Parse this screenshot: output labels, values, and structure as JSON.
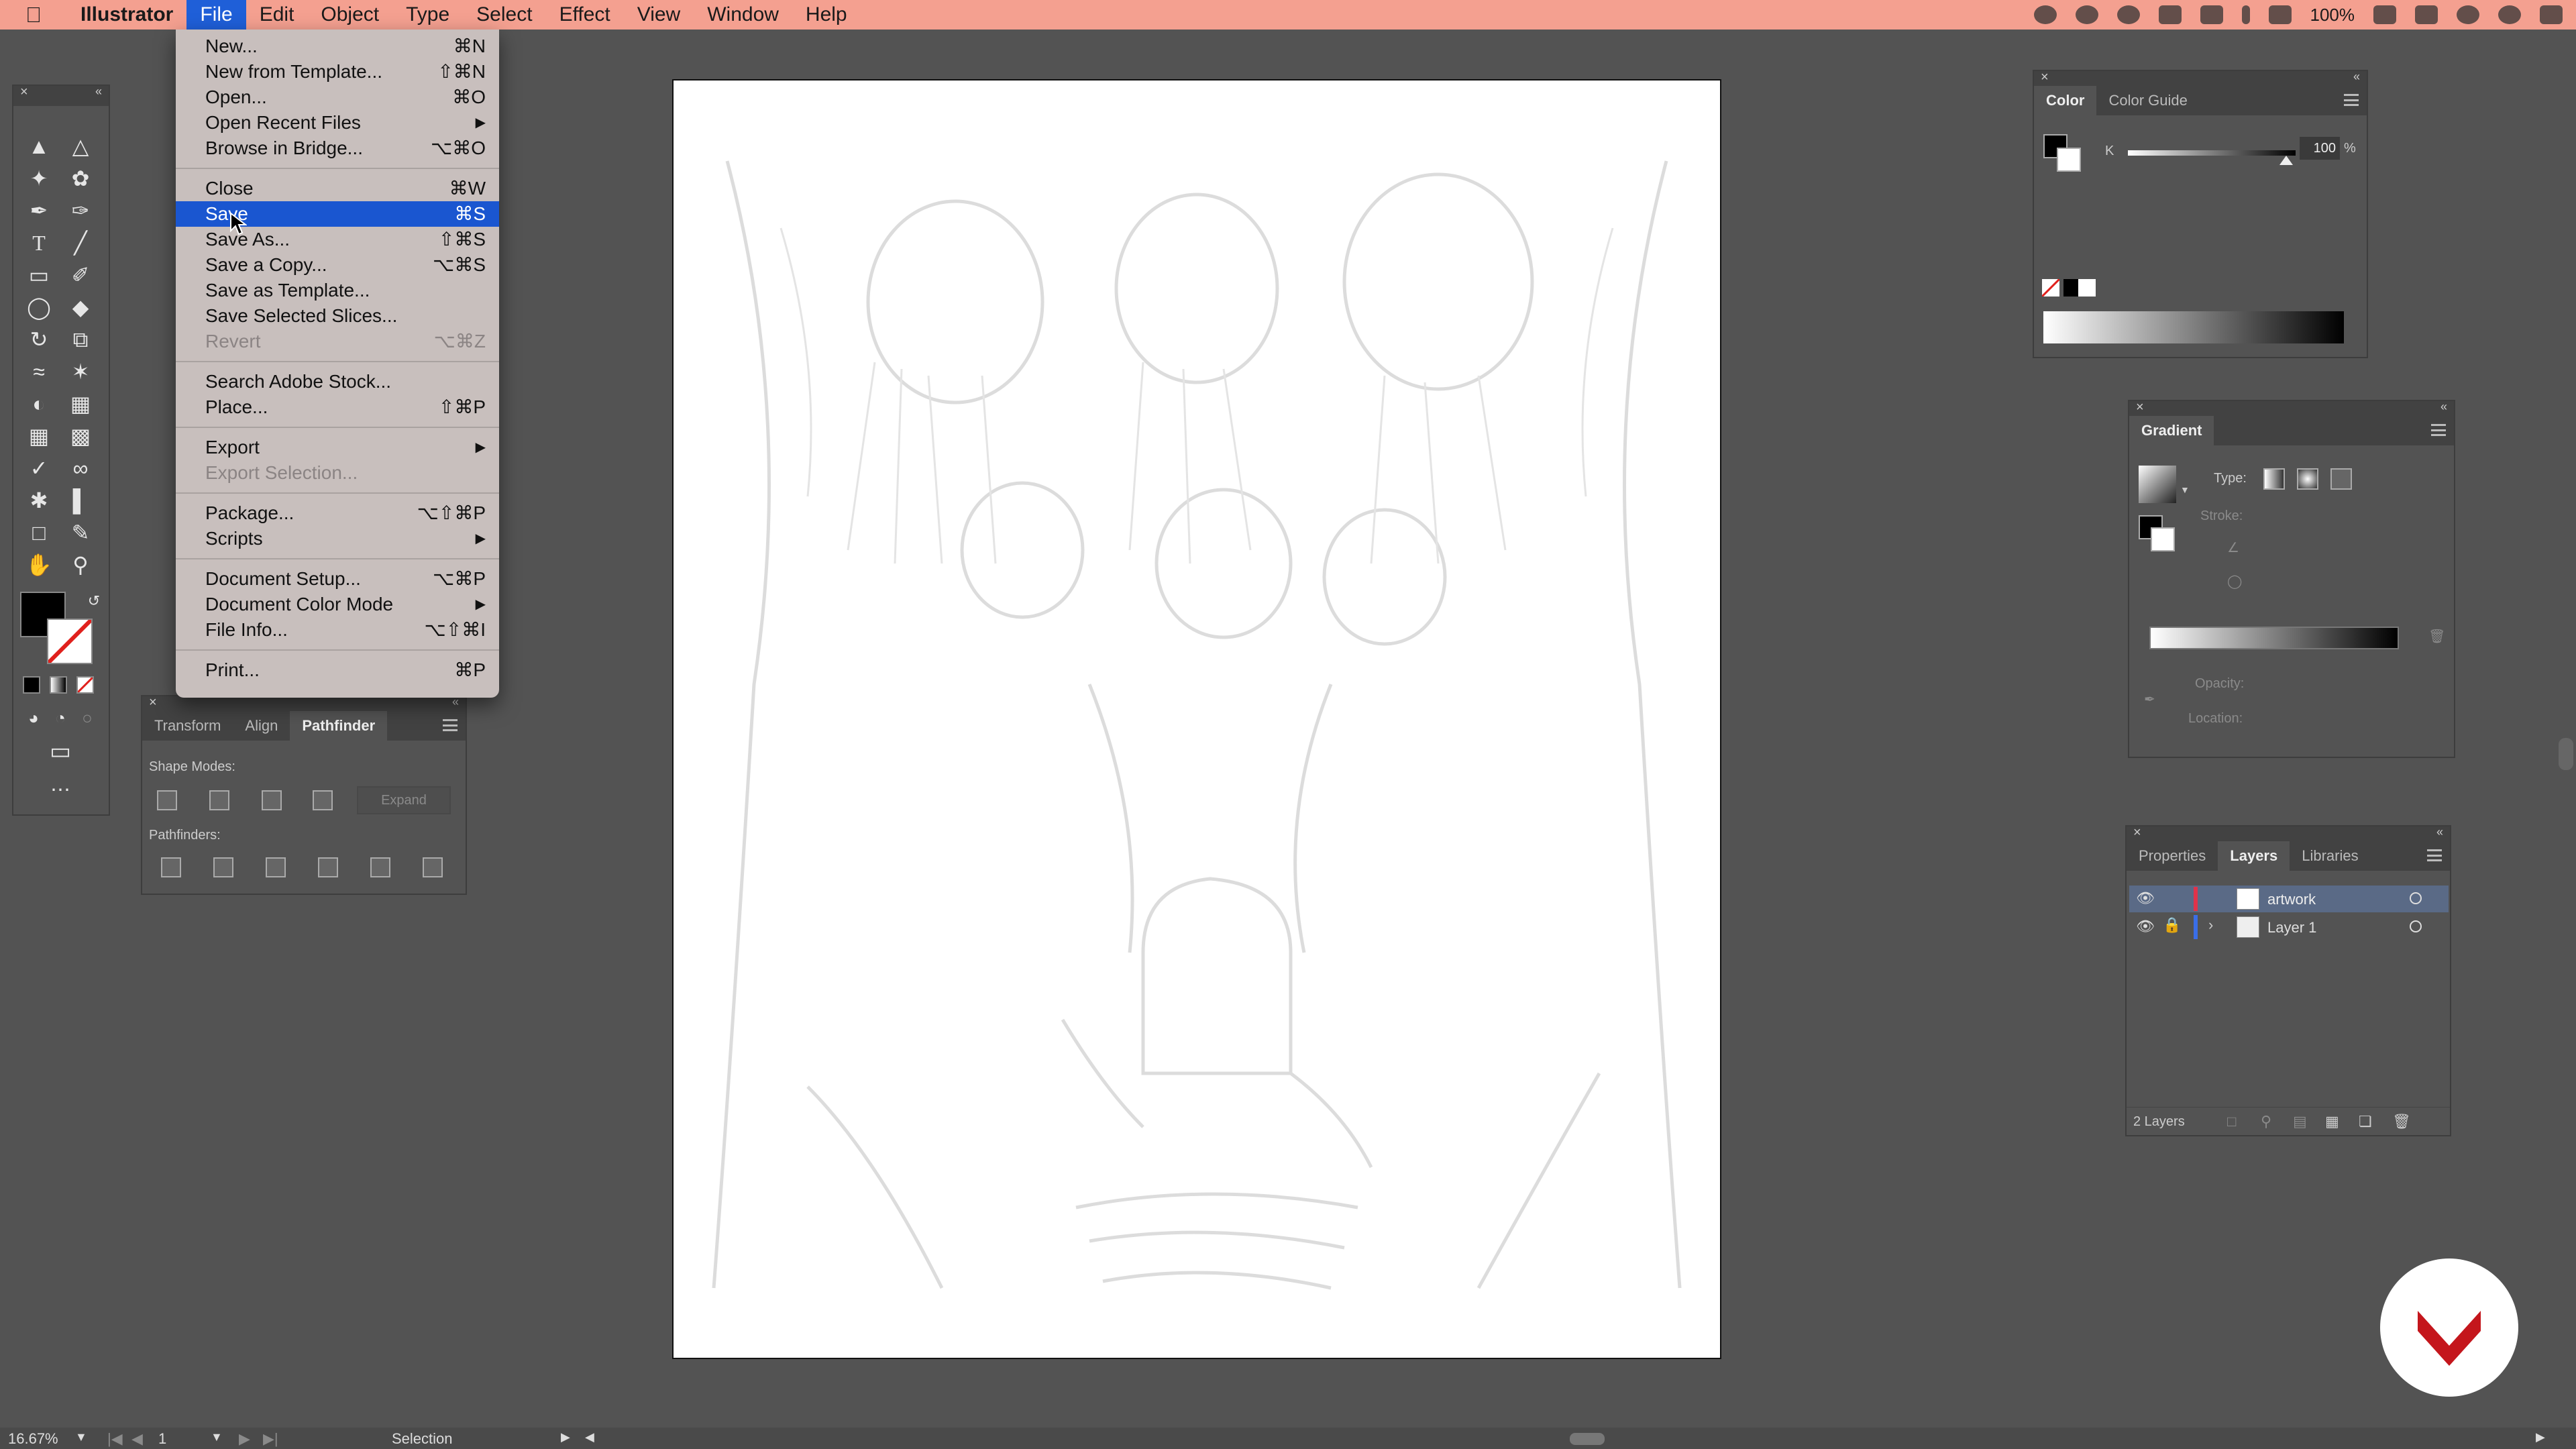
{
  "menubar": {
    "app_name": "Illustrator",
    "items": [
      "File",
      "Edit",
      "Object",
      "Type",
      "Select",
      "Effect",
      "View",
      "Window",
      "Help"
    ],
    "battery": "100%"
  },
  "file_menu": {
    "items": [
      {
        "label": "New...",
        "shortcut": "⌘N"
      },
      {
        "label": "New from Template...",
        "shortcut": "⇧⌘N"
      },
      {
        "label": "Open...",
        "shortcut": "⌘O"
      },
      {
        "label": "Open Recent Files",
        "shortcut": "▶"
      },
      {
        "label": "Browse in Bridge...",
        "shortcut": "⌥⌘O"
      },
      {
        "label": "Close",
        "shortcut": "⌘W"
      },
      {
        "label": "Save",
        "shortcut": "⌘S"
      },
      {
        "label": "Save As...",
        "shortcut": "⇧⌘S"
      },
      {
        "label": "Save a Copy...",
        "shortcut": "⌥⌘S"
      },
      {
        "label": "Save as Template...",
        "shortcut": ""
      },
      {
        "label": "Save Selected Slices...",
        "shortcut": ""
      },
      {
        "label": "Revert",
        "shortcut": "⌥⌘Z"
      },
      {
        "label": "Search Adobe Stock...",
        "shortcut": ""
      },
      {
        "label": "Place...",
        "shortcut": "⇧⌘P"
      },
      {
        "label": "Export",
        "shortcut": "▶"
      },
      {
        "label": "Export Selection...",
        "shortcut": ""
      },
      {
        "label": "Package...",
        "shortcut": "⌥⇧⌘P"
      },
      {
        "label": "Scripts",
        "shortcut": "▶"
      },
      {
        "label": "Document Setup...",
        "shortcut": "⌥⌘P"
      },
      {
        "label": "Document Color Mode",
        "shortcut": "▶"
      },
      {
        "label": "File Info...",
        "shortcut": "⌥⇧⌘I"
      },
      {
        "label": "Print...",
        "shortcut": "⌘P"
      }
    ]
  },
  "color_panel": {
    "tabs": [
      "Color",
      "Color Guide"
    ],
    "channel_label": "K",
    "value": "100",
    "unit": "%"
  },
  "gradient_panel": {
    "title": "Gradient",
    "type_label": "Type:",
    "stroke_label": "Stroke:",
    "opacity_label": "Opacity:",
    "location_label": "Location:"
  },
  "layers_panel": {
    "tabs": [
      "Properties",
      "Layers",
      "Libraries"
    ],
    "layers": [
      {
        "name": "artwork",
        "color": "#e0334a"
      },
      {
        "name": "Layer 1",
        "color": "#3a6ee8"
      }
    ],
    "count": "2 Layers"
  },
  "pathfinder_panel": {
    "tabs": [
      "Transform",
      "Align",
      "Pathfinder"
    ],
    "shape_modes_label": "Shape Modes:",
    "expand_label": "Expand",
    "pathfinders_label": "Pathfinders:"
  },
  "statusbar": {
    "zoom": "16.67%",
    "artboard": "1",
    "tool": "Selection"
  },
  "colors": {
    "menubar": "#f4a090",
    "selection": "#1a56d0",
    "badge": "#c4161c"
  }
}
